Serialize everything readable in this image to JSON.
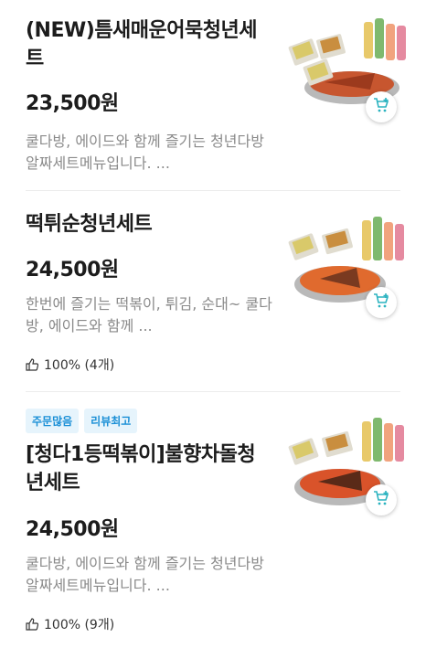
{
  "items": [
    {
      "title": "(NEW)틈새매운어묵청년세트",
      "price": "23,500원",
      "desc": "쿨다방, 에이드와 함께 즐기는 청년다방 알짜세트메뉴입니다. ...",
      "cart_icon": "cart-plus-icon"
    },
    {
      "title": "떡튀순청년세트",
      "price": "24,500원",
      "desc": "한번에 즐기는 떡볶이, 튀김, 순대~ 쿨다방, 에이드와 함께 ...",
      "rating": "100% (4개)",
      "cart_icon": "cart-plus-icon"
    },
    {
      "badges": [
        "주문많음",
        "리뷰최고"
      ],
      "title": "[청다1등떡볶이]불향차돌청년세트",
      "price": "24,500원",
      "desc": "쿨다방, 에이드와 함께 즐기는 청년다방 알짜세트메뉴입니다. ...",
      "rating": "100% (9개)",
      "cart_icon": "cart-plus-icon"
    }
  ],
  "colors": {
    "badge_text": "#1a8fd6",
    "badge_bg": "#e6f4fc",
    "cart_accent": "#2bb3c0"
  }
}
